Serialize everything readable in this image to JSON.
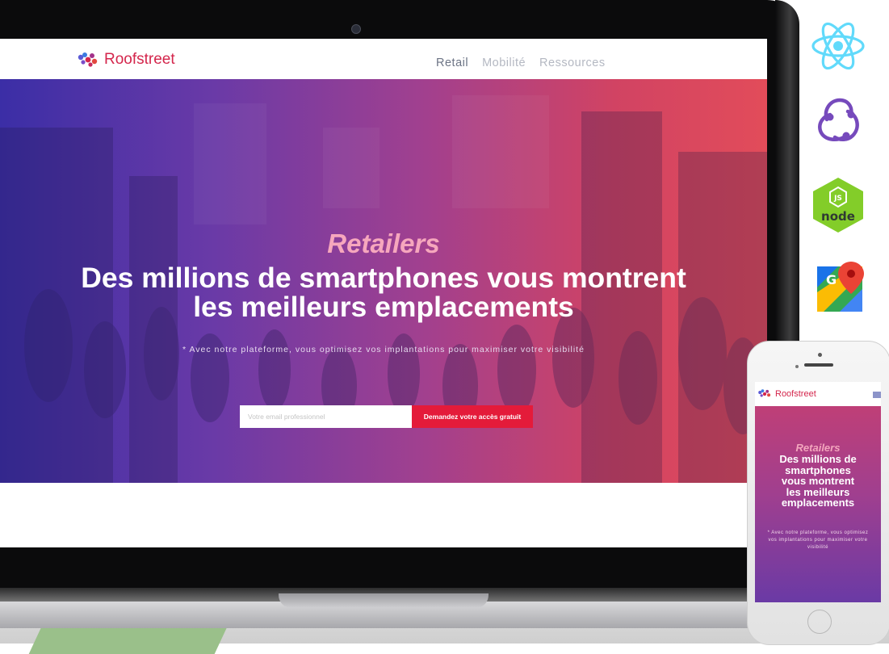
{
  "laptop_site": {
    "brand": "Roofstreet",
    "nav": [
      {
        "label": "Retail",
        "active": true
      },
      {
        "label": "Mobilité",
        "active": false
      },
      {
        "label": "Ressources",
        "active": false
      }
    ],
    "hero": {
      "eyebrow": "Retailers",
      "title_line1": "Des millions de smartphones vous montrent",
      "title_line2": "les meilleurs emplacements",
      "subtitle": "* Avec notre plateforme, vous optimisez vos implantations pour maximiser votre visibilité",
      "email_placeholder": "Votre email professionnel",
      "cta_label": "Demandez votre accès gratuit"
    }
  },
  "phone_site": {
    "brand": "Roofstreet",
    "hero": {
      "eyebrow": "Retailers",
      "title_lines": [
        "Des millions de",
        "smartphones",
        "vous montrent",
        "les meilleurs",
        "emplacements"
      ],
      "subtitle": "* Avec notre plateforme, vous optimisez vos implantations pour maximiser votre visibilité"
    }
  },
  "tech_icons": [
    "react-icon",
    "redux-icon",
    "nodejs-icon",
    "google-maps-icon"
  ],
  "colors": {
    "brand_red": "#d4264c",
    "cta_red": "#e41b3a",
    "hero_start": "#3b2ea6",
    "hero_end": "#e24c5a",
    "eyebrow_pink": "#f6a7bd",
    "react_blue": "#61dafb",
    "redux_purple": "#764abc",
    "node_green": "#83cd29"
  }
}
